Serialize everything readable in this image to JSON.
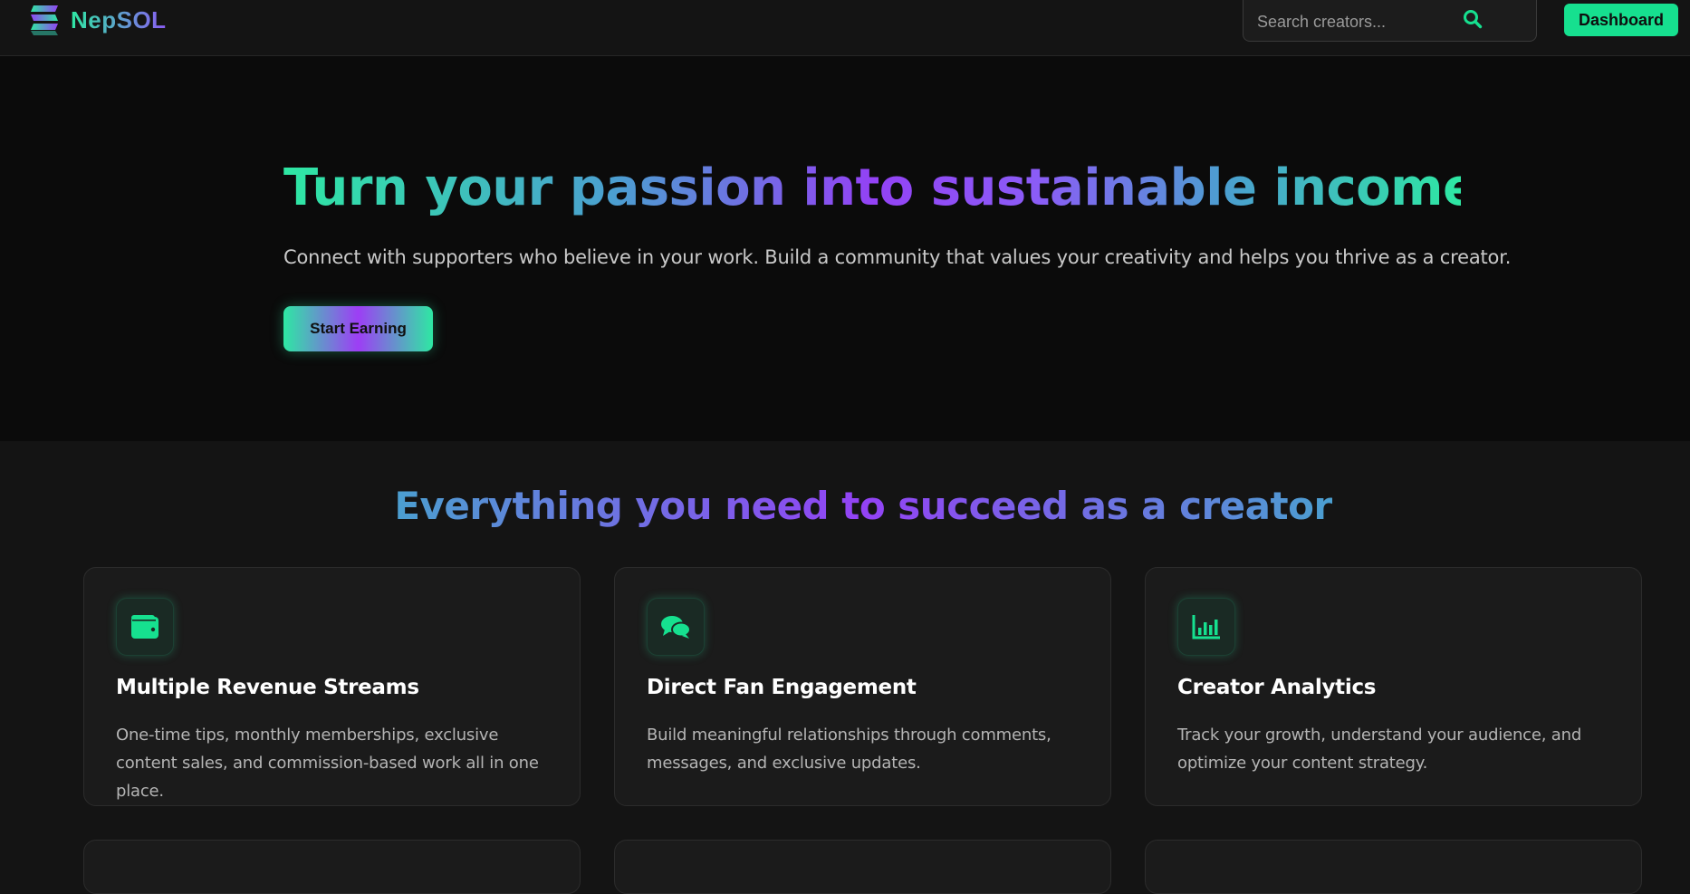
{
  "brand": {
    "name": "NepSOL",
    "logo_icon": "layered-s-logo-icon"
  },
  "header": {
    "search": {
      "placeholder": "Search creators...",
      "icon": "search-icon"
    },
    "dashboard_label": "Dashboard"
  },
  "hero": {
    "title": "Turn your passion into sustainable income",
    "subtitle": "Connect with supporters who believe in your work. Build a community that values your creativity and helps you thrive as a creator.",
    "cta_label": "Start Earning"
  },
  "features": {
    "title": "Everything you need to succeed as a creator",
    "cards": [
      {
        "icon": "wallet-icon",
        "title": "Multiple Revenue Streams",
        "description": "One-time tips, monthly memberships, exclusive content sales, and commission-based work all in one place."
      },
      {
        "icon": "chat-bubbles-icon",
        "title": "Direct Fan Engagement",
        "description": "Build meaningful relationships through comments, messages, and exclusive updates."
      },
      {
        "icon": "bar-chart-icon",
        "title": "Creator Analytics",
        "description": "Track your growth, understand your audience, and optimize your content strategy."
      }
    ]
  },
  "colors": {
    "accent_green": "#16e08f",
    "accent_purple": "#9342f5",
    "accent_blue": "#4b9fd0",
    "background": "#141414"
  }
}
